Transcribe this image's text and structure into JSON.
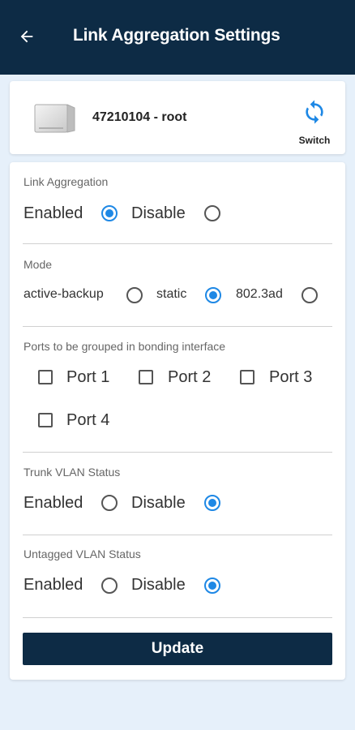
{
  "header": {
    "title": "Link Aggregation Settings",
    "back_icon": "arrow-left-icon",
    "background": "#0d2b45"
  },
  "device": {
    "name": "47210104 - root",
    "image_icon": "router-device-icon",
    "switch_label": "Switch",
    "switch_icon": "sync-icon"
  },
  "link_aggregation": {
    "label": "Link Aggregation",
    "options": [
      {
        "label": "Enabled",
        "selected": true
      },
      {
        "label": "Disable",
        "selected": false
      }
    ]
  },
  "mode": {
    "label": "Mode",
    "options": [
      {
        "label": "active-backup",
        "selected": false
      },
      {
        "label": "static",
        "selected": true
      },
      {
        "label": "802.3ad",
        "selected": false
      }
    ]
  },
  "ports": {
    "label": "Ports to be grouped in bonding interface",
    "items": [
      {
        "label": "Port 1",
        "checked": false
      },
      {
        "label": "Port 2",
        "checked": false
      },
      {
        "label": "Port 3",
        "checked": false
      },
      {
        "label": "Port 4",
        "checked": false
      }
    ]
  },
  "trunk_vlan": {
    "label": "Trunk VLAN Status",
    "options": [
      {
        "label": "Enabled",
        "selected": false
      },
      {
        "label": "Disable",
        "selected": true
      }
    ]
  },
  "untagged_vlan": {
    "label": "Untagged VLAN Status",
    "options": [
      {
        "label": "Enabled",
        "selected": false
      },
      {
        "label": "Disable",
        "selected": true
      }
    ]
  },
  "actions": {
    "update_label": "Update"
  },
  "colors": {
    "accent": "#1e88e5",
    "primary": "#0d2b45",
    "page_background": "#e6f0fa"
  }
}
